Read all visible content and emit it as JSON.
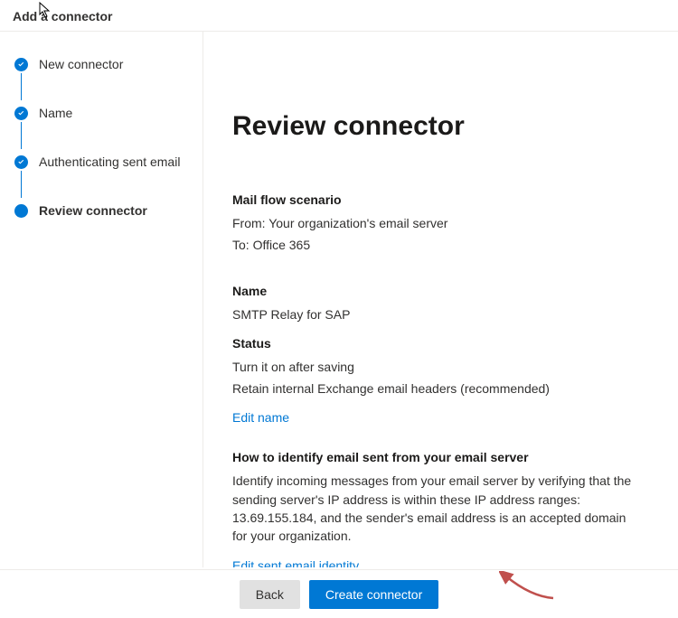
{
  "header": {
    "title": "Add a connector"
  },
  "sidebar": {
    "steps": [
      {
        "label": "New connector",
        "done": true
      },
      {
        "label": "Name",
        "done": true
      },
      {
        "label": "Authenticating sent email",
        "done": true
      },
      {
        "label": "Review connector",
        "done": false,
        "current": true
      }
    ]
  },
  "content": {
    "heading": "Review connector",
    "scenario": {
      "title": "Mail flow scenario",
      "from": "From: Your organization's email server",
      "to": "To: Office 365"
    },
    "name": {
      "title": "Name",
      "value": "SMTP Relay for SAP"
    },
    "status": {
      "title": "Status",
      "line1": "Turn it on after saving",
      "line2": "Retain internal Exchange email headers (recommended)",
      "edit_link": "Edit name"
    },
    "identify": {
      "title": "How to identify email sent from your email server",
      "body": "Identify incoming messages from your email server by verifying that the sending server's IP address is within these IP address ranges: 13.69.155.184, and the sender's email address is an accepted domain for your organization.",
      "edit_link": "Edit sent email identity"
    }
  },
  "footer": {
    "back_label": "Back",
    "create_label": "Create connector"
  },
  "colors": {
    "primary": "#0078d4",
    "arrow": "#c0504d"
  }
}
